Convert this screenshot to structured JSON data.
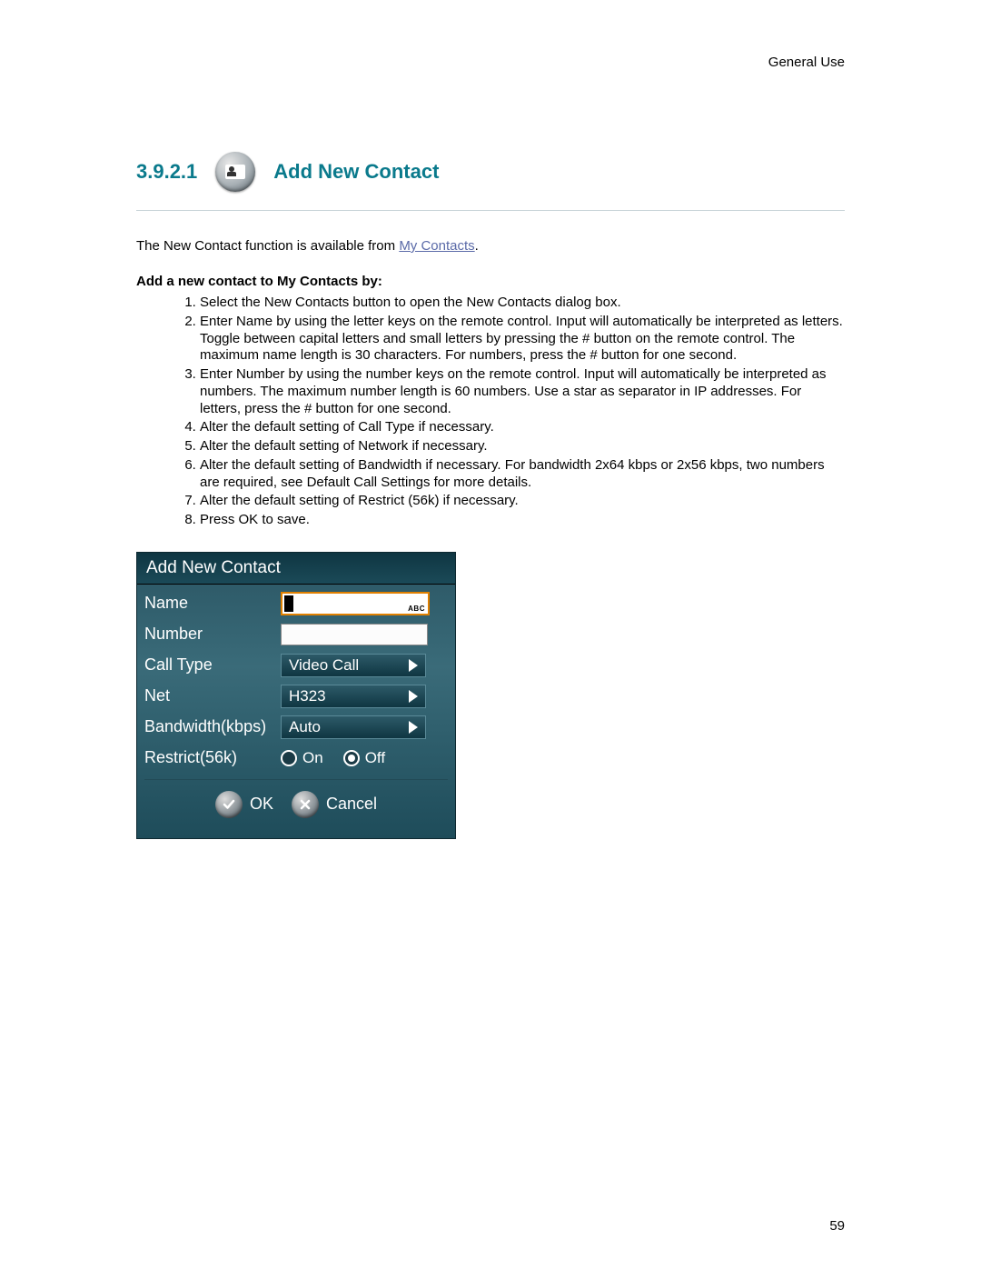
{
  "header": {
    "category": "General Use"
  },
  "section": {
    "number": "3.9.2.1",
    "title": "Add New Contact"
  },
  "intro": {
    "before_link": "The New Contact function is available from ",
    "link_text": "My Contacts",
    "after_link": "."
  },
  "subheading": "Add a new contact to My Contacts by:",
  "steps": [
    "Select the New Contacts button to open the New Contacts dialog box.",
    "Enter Name by using the letter keys on the remote control. Input will automatically be interpreted as letters. Toggle between capital letters and small letters by pressing the # button on the remote control. The maximum name length is 30 characters. For numbers, press the # button for one second.",
    "Enter Number by using the number keys on the remote control. Input will automatically be interpreted as numbers. The maximum number length is 60 numbers. Use a star as separator in IP addresses. For letters, press the # button for one second.",
    "Alter the default setting of Call Type if necessary.",
    "Alter the default setting of Network if necessary.",
    "Alter the default setting of Bandwidth if necessary. For bandwidth 2x64 kbps or 2x56 kbps, two numbers are required, see Default Call Settings for more details.",
    "Alter the default setting of Restrict (56k) if necessary.",
    "Press OK to save."
  ],
  "dialog": {
    "title": "Add New Contact",
    "labels": {
      "name": "Name",
      "number": "Number",
      "call_type": "Call Type",
      "net": "Net",
      "bandwidth": "Bandwidth(kbps)",
      "restrict": "Restrict(56k)"
    },
    "values": {
      "name_mode": "ABC",
      "call_type": "Video Call",
      "net": "H323",
      "bandwidth": "Auto",
      "restrict_on": "On",
      "restrict_off": "Off",
      "restrict_selected": "Off"
    },
    "buttons": {
      "ok": "OK",
      "cancel": "Cancel"
    }
  },
  "page_number": "59"
}
